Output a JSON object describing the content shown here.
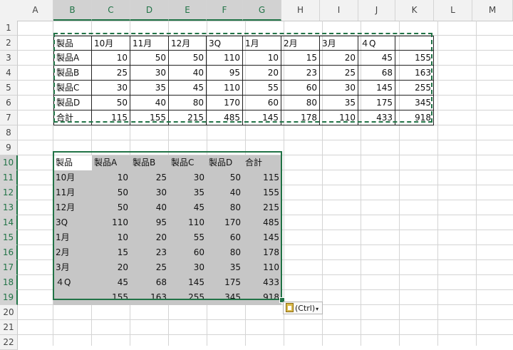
{
  "columns": [
    "A",
    "B",
    "C",
    "D",
    "E",
    "F",
    "G",
    "H",
    "I",
    "J",
    "K",
    "L",
    "M"
  ],
  "rows": [
    "1",
    "2",
    "3",
    "4",
    "5",
    "6",
    "7",
    "8",
    "9",
    "10",
    "11",
    "12",
    "13",
    "14",
    "15",
    "16",
    "17",
    "18",
    "19",
    "20",
    "21",
    "22"
  ],
  "source_table": {
    "header": [
      "製品",
      "10月",
      "11月",
      "12月",
      "3Q",
      "1月",
      "2月",
      "3月",
      "４Q",
      ""
    ],
    "rows": [
      [
        "製品A",
        "10",
        "50",
        "50",
        "110",
        "10",
        "15",
        "20",
        "45",
        "155"
      ],
      [
        "製品B",
        "25",
        "30",
        "40",
        "95",
        "20",
        "23",
        "25",
        "68",
        "163"
      ],
      [
        "製品C",
        "30",
        "35",
        "45",
        "110",
        "55",
        "60",
        "30",
        "145",
        "255"
      ],
      [
        "製品D",
        "50",
        "40",
        "80",
        "170",
        "60",
        "80",
        "35",
        "175",
        "345"
      ],
      [
        "合計",
        "115",
        "155",
        "215",
        "485",
        "145",
        "178",
        "110",
        "433",
        "918"
      ]
    ]
  },
  "pasted_table": {
    "header": [
      "製品",
      "製品A",
      "製品B",
      "製品C",
      "製品D",
      "合計"
    ],
    "rows": [
      [
        "10月",
        "10",
        "25",
        "30",
        "50",
        "115"
      ],
      [
        "11月",
        "50",
        "30",
        "35",
        "40",
        "155"
      ],
      [
        "12月",
        "50",
        "40",
        "45",
        "80",
        "215"
      ],
      [
        "3Q",
        "110",
        "95",
        "110",
        "170",
        "485"
      ],
      [
        "1月",
        "10",
        "20",
        "55",
        "60",
        "145"
      ],
      [
        "2月",
        "15",
        "23",
        "60",
        "80",
        "178"
      ],
      [
        "3月",
        "20",
        "25",
        "30",
        "35",
        "110"
      ],
      [
        "４Q",
        "45",
        "68",
        "145",
        "175",
        "433"
      ],
      [
        "",
        "155",
        "163",
        "255",
        "345",
        "918"
      ]
    ]
  },
  "paste_options": {
    "label": "(Ctrl)",
    "arrow": "▾"
  },
  "colors": {
    "accent": "#217346",
    "selection_fill": "#c6c6c6"
  }
}
